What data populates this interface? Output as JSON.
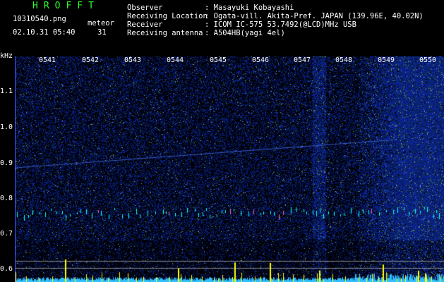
{
  "header": {
    "brand": "HROFFT",
    "filename": "10310540.png",
    "datetime": "02.10.31 05:40",
    "meteor_label": "meteor",
    "meteor_count": "31",
    "fields": [
      {
        "label": "Observer",
        "value": ": Masayuki Kobayashi"
      },
      {
        "label": "Receiving Location",
        "value": ": Ogata-vill. Akita-Pref. JAPAN (139.96E, 40.02N)"
      },
      {
        "label": "Receiver",
        "value": ": ICOM IC-575 53.7492(@LCD)MHz USB"
      },
      {
        "label": "Receiving antenna",
        "value": ": A504HB(yagi 4el)"
      }
    ]
  },
  "axis": {
    "unit": "kHz",
    "y_ticks": [
      "1.1",
      "1.0",
      "0.9",
      "0.8",
      "0.7",
      "0.6"
    ],
    "time_ticks": [
      "0541",
      "0542",
      "0543",
      "0544",
      "0545",
      "0546",
      "0547",
      "0548",
      "0549",
      "0550"
    ]
  },
  "colors": {
    "background": "#000000",
    "noise_blue": "#1a2a9a",
    "trace": "#4a78ff",
    "meteor_echo": "#00ffff",
    "peak_yellow": "#ffff00",
    "brand_green": "#28ff28"
  }
}
